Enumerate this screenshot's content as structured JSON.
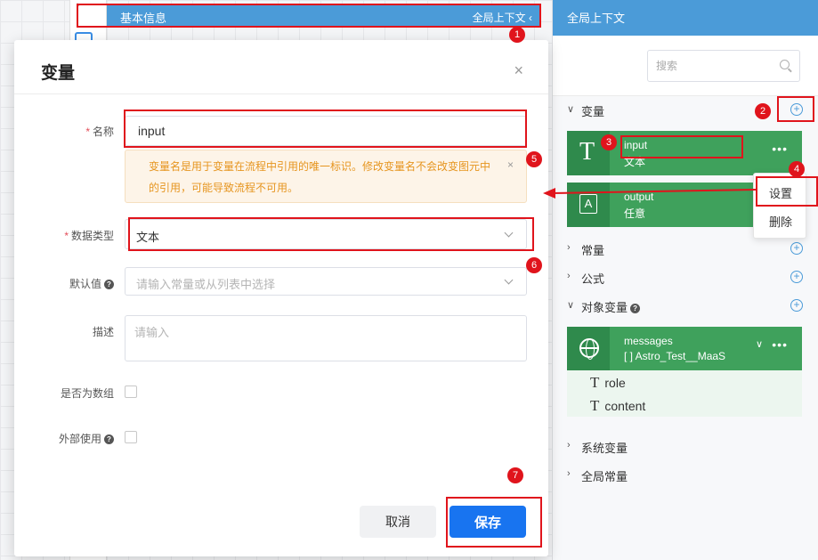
{
  "topbar": {
    "title": "基本信息",
    "right_label": "全局上下文",
    "right_chevron": "‹"
  },
  "panel": {
    "title": "全局上下文",
    "search_placeholder": "搜索",
    "sections": {
      "variables": "变量",
      "constants": "常量",
      "formulas": "公式",
      "object_variables": "对象变量",
      "system_variables": "系统变量",
      "global_constants": "全局常量"
    },
    "variables": [
      {
        "name": "input",
        "type": "文本",
        "icon": "text-type-icon"
      },
      {
        "name": "output",
        "type": "任意",
        "icon": "any-type-icon"
      }
    ],
    "object_variable": {
      "name": "messages",
      "type": "[ ] Astro_Test__MaaS",
      "icon": "globe-icon",
      "fields": [
        "role",
        "content"
      ]
    },
    "popover": {
      "settings": "设置",
      "delete": "删除"
    },
    "more_glyph": "•••"
  },
  "modal": {
    "title": "变量",
    "close_glyph": "×",
    "name_label": "名称",
    "required_mark": "*",
    "name_value": "input",
    "warning_text": "变量名是用于变量在流程中引用的唯一标识。修改变量名不会改变图元中的引用，可能导致流程不可用。",
    "warning_close": "×",
    "datatype_label": "数据类型",
    "datatype_value": "文本",
    "default_label": "默认值",
    "default_placeholder": "请输入常量或从列表中选择",
    "desc_label": "描述",
    "desc_placeholder": "请输入",
    "is_array_label": "是否为数组",
    "external_label": "外部使用",
    "cancel_label": "取消",
    "save_label": "保存"
  },
  "badges": [
    "1",
    "2",
    "3",
    "4",
    "5",
    "6",
    "7"
  ],
  "colors": {
    "header_blue": "#4b9bd8",
    "card_green": "#3fa15c",
    "primary_button": "#1874f0",
    "annotation_red": "#e0141c",
    "warning_text": "#e6951f"
  }
}
